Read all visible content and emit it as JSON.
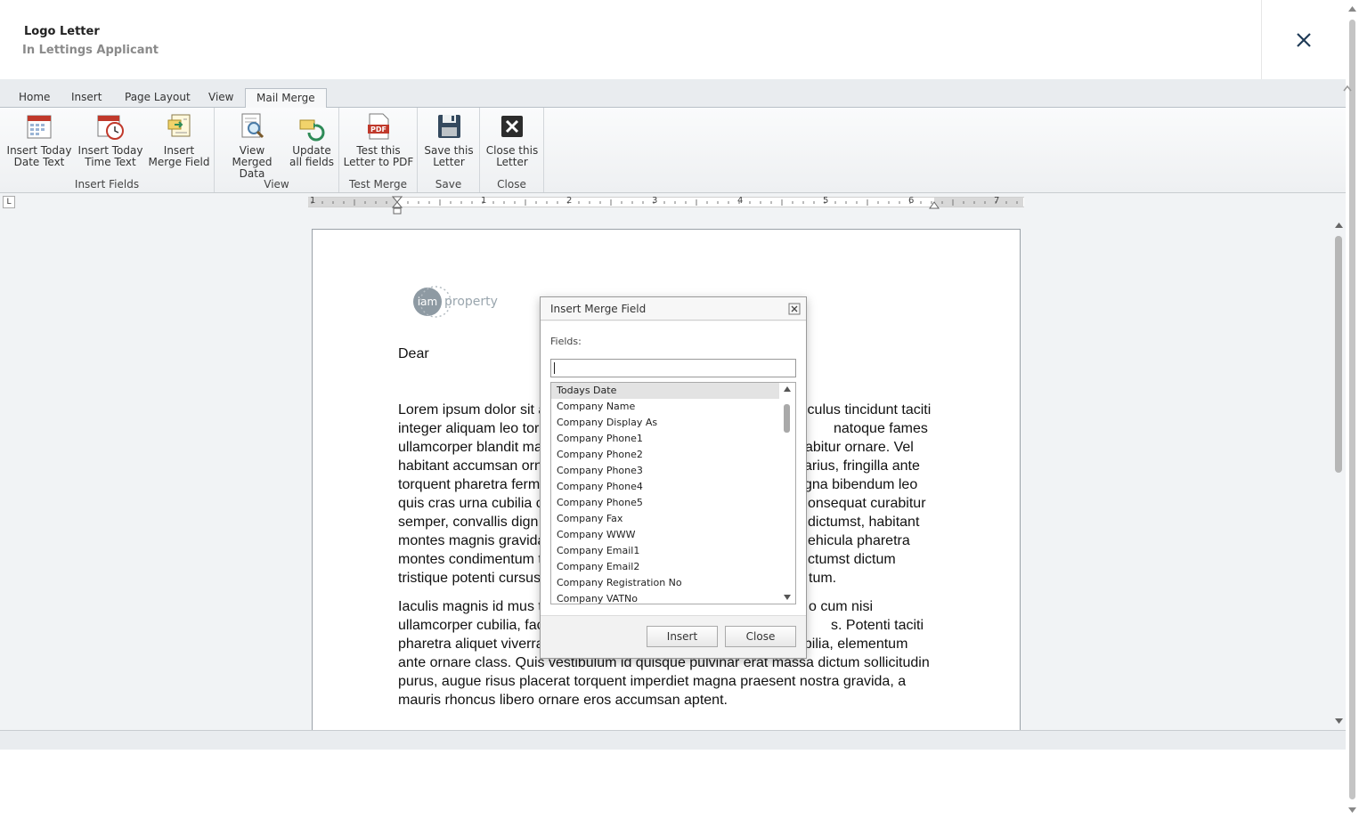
{
  "header": {
    "title": "Logo Letter",
    "subtitle": "In Lettings Applicant"
  },
  "tabs": [
    {
      "label": "Home",
      "active": false
    },
    {
      "label": "Insert",
      "active": false
    },
    {
      "label": "Page Layout",
      "active": false
    },
    {
      "label": "View",
      "active": false
    },
    {
      "label": "Mail Merge",
      "active": true
    }
  ],
  "ribbon": {
    "groups": {
      "insert_fields": "Insert Fields",
      "view": "View",
      "test_merge": "Test Merge",
      "save": "Save",
      "close": "Close"
    },
    "buttons": {
      "insert_date": [
        "Insert Today",
        "Date Text"
      ],
      "insert_time": [
        "Insert Today",
        "Time Text"
      ],
      "insert_merge": [
        "Insert",
        "Merge Field"
      ],
      "view_merged": [
        "View Merged",
        "Data"
      ],
      "update_fields": [
        "Update",
        "all fields"
      ],
      "test_pdf": [
        "Test this",
        "Letter to PDF"
      ],
      "save_letter": [
        "Save this",
        "Letter"
      ],
      "close_letter": [
        "Close this",
        "Letter"
      ]
    }
  },
  "ruler": {
    "numbers": [
      "1",
      "1",
      "2",
      "3",
      "4",
      "5",
      "6",
      "7"
    ]
  },
  "document": {
    "logo_text": {
      "a": "iam",
      "b": "property"
    },
    "dear": "Dear",
    "para1_lines": [
      "Lorem ipsum dolor sit a",
      "integer aliquam leo tor",
      "ullamcorper blandit ma",
      "habitant accumsan orn",
      "torquent pharetra ferm",
      "quis cras urna cubilia c",
      "semper, convallis dign",
      "montes magnis gravida",
      "montes condimentum t",
      "tristique potenti cursus"
    ],
    "para1_right": [
      "iculus tincidunt taciti",
      "natoque fames",
      "abitur ornare. Vel",
      "arius, fringilla ante",
      "gna bibendum leo",
      "onsequat curabitur",
      "dictumst, habitant",
      "ehicula pharetra",
      "ctumst dictum",
      "tum."
    ],
    "para2_lines": [
      "Iaculis magnis id mus t",
      "ullamcorper cubilia, fac",
      "pharetra aliquet viverra",
      "ante ornare class. Quis vestibulum id quisque pulvinar erat massa dictum sollicitudin",
      "purus, augue risus placerat torquent imperdiet magna praesent nostra gravida, a",
      "mauris rhoncus libero ornare eros accumsan aptent."
    ],
    "para2_right": [
      "o cum nisi",
      "s. Potenti taciti",
      "ubilia, elementum"
    ]
  },
  "dialog": {
    "title": "Insert Merge Field",
    "fields_label": "Fields:",
    "search_value": "",
    "items": [
      "Todays Date",
      "Company Name",
      "Company Display As",
      "Company Phone1",
      "Company Phone2",
      "Company Phone3",
      "Company Phone4",
      "Company Phone5",
      "Company Fax",
      "Company WWW",
      "Company Email1",
      "Company Email2",
      "Company Registration No",
      "Company VATNo"
    ],
    "selected": "Todays Date",
    "insert_label": "Insert",
    "close_label": "Close"
  },
  "colors": {
    "accent_red": "#c0392b",
    "dialog_border": "#9a9a9a",
    "tab_bg": "#e9ecef"
  }
}
